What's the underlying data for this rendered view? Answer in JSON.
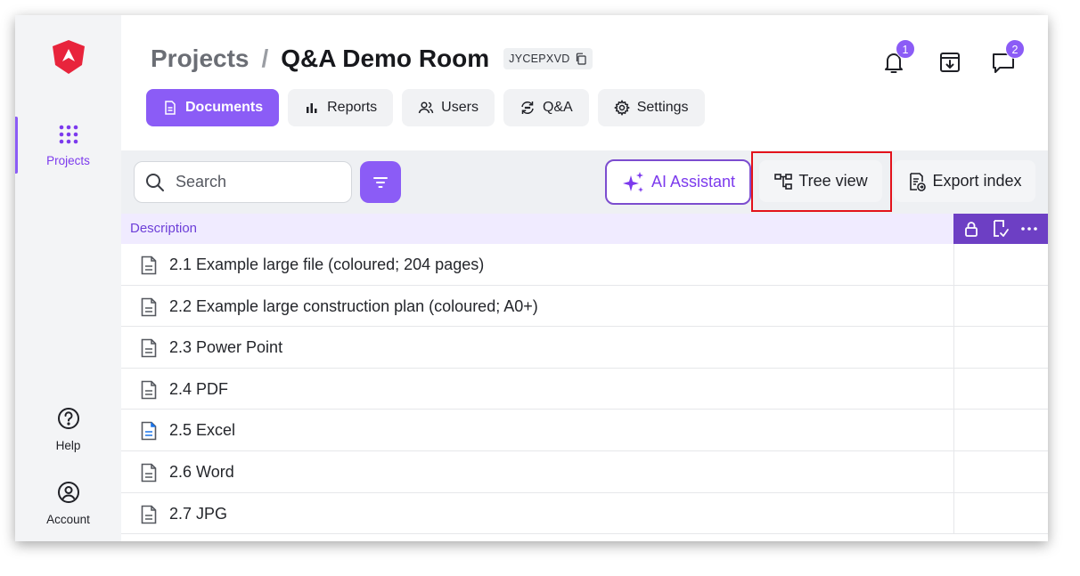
{
  "sidebar": {
    "logo": "angular-shield-logo",
    "items": [
      {
        "label": "Projects",
        "icon": "grid-dots-icon",
        "active": true
      },
      {
        "label": "Help",
        "icon": "question-circle-icon"
      },
      {
        "label": "Account",
        "icon": "user-circle-icon"
      }
    ]
  },
  "header": {
    "breadcrumb_root": "Projects",
    "breadcrumb_sep": "/",
    "room_title": "Q&A Demo Room",
    "room_code": "JYCEPXVD",
    "notifications_count": "1",
    "messages_count": "2"
  },
  "tabs": [
    {
      "label": "Documents",
      "icon": "document-icon",
      "active": true
    },
    {
      "label": "Reports",
      "icon": "bar-chart-icon"
    },
    {
      "label": "Users",
      "icon": "users-icon"
    },
    {
      "label": "Q&A",
      "icon": "refresh-chat-icon"
    },
    {
      "label": "Settings",
      "icon": "gear-icon"
    }
  ],
  "toolbar": {
    "search_placeholder": "Search",
    "ai_assistant_label": "AI Assistant",
    "tree_view_label": "Tree view",
    "export_index_label": "Export index"
  },
  "table": {
    "column_description": "Description",
    "rows": [
      {
        "name": "2.1 Example large file (coloured; 204 pages)",
        "icon": "file-icon"
      },
      {
        "name": "2.2 Example large construction plan (coloured; A0+)",
        "icon": "file-icon"
      },
      {
        "name": "2.3 Power Point",
        "icon": "file-icon"
      },
      {
        "name": "2.4 PDF",
        "icon": "file-icon"
      },
      {
        "name": "2.5 Excel",
        "icon": "file-blue-icon"
      },
      {
        "name": "2.6 Word",
        "icon": "file-icon"
      },
      {
        "name": "2.7 JPG",
        "icon": "file-icon"
      }
    ]
  },
  "colors": {
    "accent": "#8b5cf6",
    "accent_dark": "#6d3fc4",
    "highlight": "#e3121b",
    "logo_red": "#e8243c"
  }
}
